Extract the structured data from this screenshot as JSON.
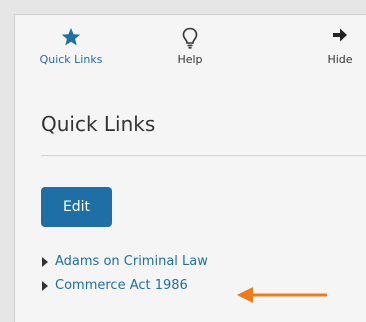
{
  "toolbar": {
    "quick_links": {
      "label": "Quick Links",
      "icon": "star-icon",
      "color": "#1d6fa5"
    },
    "help": {
      "label": "Help",
      "icon": "lightbulb-icon"
    },
    "hide": {
      "label": "Hide",
      "icon": "arrow-right-icon"
    }
  },
  "page": {
    "title": "Quick Links",
    "edit_label": "Edit",
    "accent": "#1e6fa6",
    "links": [
      {
        "label": "Adams on Criminal Law"
      },
      {
        "label": "Commerce Act 1986"
      }
    ],
    "annotation_arrow_color": "#f07a1a"
  }
}
